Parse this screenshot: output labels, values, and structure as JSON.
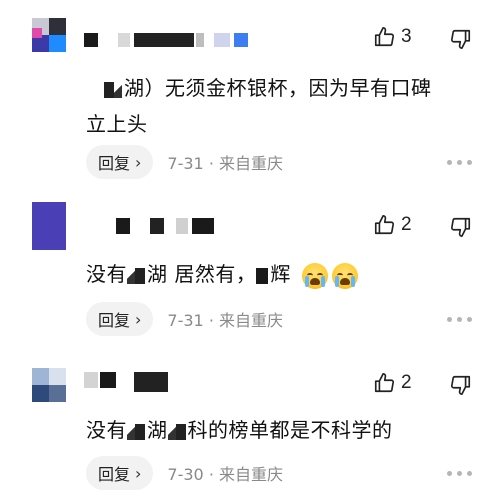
{
  "comments": [
    {
      "likes": "3",
      "text_parts": [
        "湖）无须金杯银杯，因为早有口碑",
        "立上头"
      ],
      "reply_label": "回复",
      "date": "7-31",
      "location": "来自重庆"
    },
    {
      "likes": "2",
      "text_parts": [
        "没有",
        "湖 居然有，",
        "辉"
      ],
      "reply_label": "回复",
      "date": "7-31",
      "location": "来自重庆"
    },
    {
      "likes": "2",
      "text_parts": [
        "没有",
        "湖",
        "科的榜单都是不科学的"
      ],
      "reply_label": "回复",
      "date": "7-30",
      "location": "来自重庆"
    }
  ],
  "meta_separator": "·",
  "colors": {
    "meta_gray": "#8a8a8a",
    "reply_bg": "#f2f2f2"
  },
  "icons": {
    "like": "thumbs-up-icon",
    "dislike": "thumbs-down-icon",
    "more": "more-horizontal-icon",
    "chevron": "chevron-right-icon"
  }
}
